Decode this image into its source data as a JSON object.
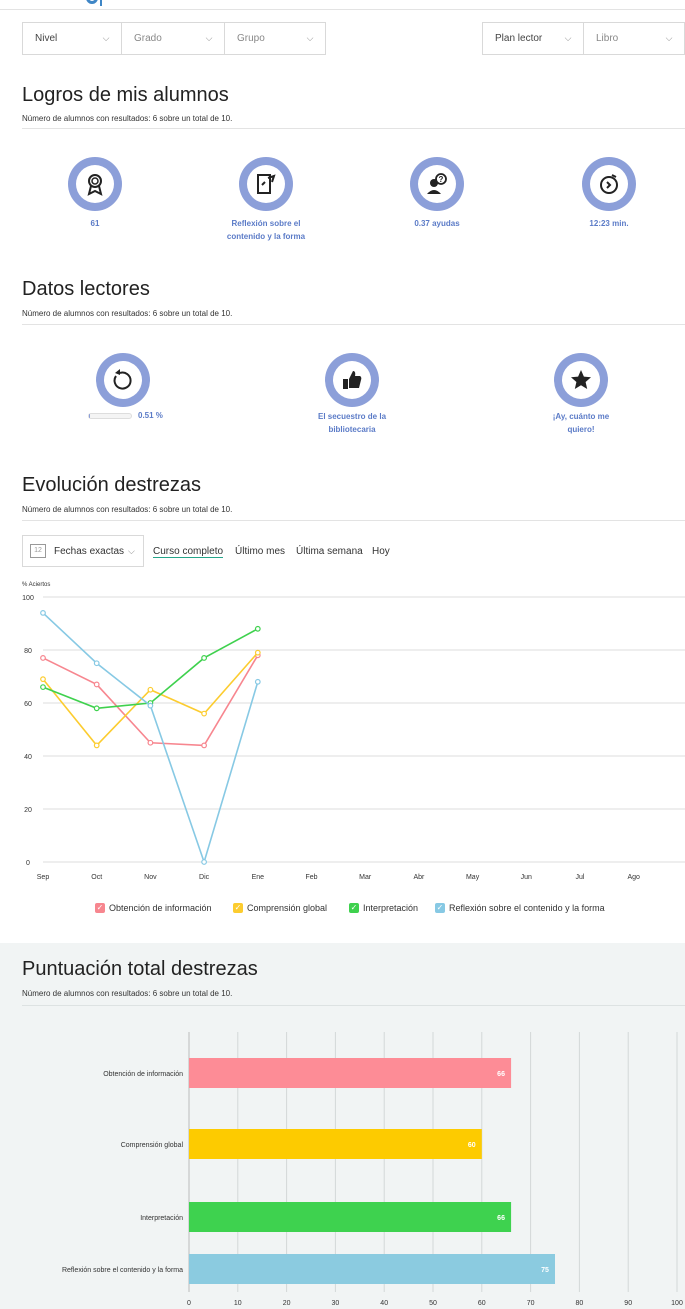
{
  "filters": {
    "nivel": "Nivel",
    "grado": "Grado",
    "grupo": "Grupo",
    "plan_lector": "Plan lector",
    "libro": "Libro"
  },
  "logros": {
    "title": "Logros de mis alumnos",
    "subtitle": "Número de alumnos con resultados: 6 sobre un total de 10.",
    "stats": [
      {
        "icon": "award-icon",
        "line1": "61",
        "line2": ""
      },
      {
        "icon": "document-edit-icon",
        "line1": "Reflexión sobre el",
        "line2": "contenido y la forma"
      },
      {
        "icon": "help-user-icon",
        "line1": "0.37 ayudas",
        "line2": ""
      },
      {
        "icon": "timer-icon",
        "line1": "12:23 min.",
        "line2": ""
      }
    ]
  },
  "datos": {
    "title": "Datos lectores",
    "subtitle": "Número de alumnos con resultados: 6 sobre un total de 10.",
    "progress_label": "0.51 %",
    "progress_value": 0.0051,
    "stats": [
      {
        "icon": "refresh-icon",
        "line1": "",
        "line2": ""
      },
      {
        "icon": "thumbs-up-icon",
        "line1": "El secuestro de la",
        "line2": "bibliotecaria"
      },
      {
        "icon": "star-icon",
        "line1": "¡Ay, cuánto me",
        "line2": "quiero!"
      }
    ]
  },
  "evolucion": {
    "title": "Evolución destrezas",
    "subtitle": "Número de alumnos con resultados: 6 sobre un total de 10.",
    "date_button": "Fechas exactas",
    "calendar_day": "12",
    "ranges": [
      "Curso completo",
      "Último mes",
      "Última semana",
      "Hoy"
    ],
    "active_range": "Curso completo"
  },
  "puntuacion": {
    "title": "Puntuación total destrezas",
    "subtitle": "Número de alumnos con resultados: 6 sobre un total de 10."
  },
  "colors": {
    "obtencion": "#f7868f",
    "comprension": "#fccc2f",
    "interpretacion": "#3fd14e",
    "reflexion": "#87c9e4",
    "accent": "#8c9fd9",
    "stat_text": "#5b7bc7"
  },
  "chart_data": [
    {
      "type": "line",
      "ylabel": "% Aciertos",
      "ylim": [
        0,
        100
      ],
      "yticks": [
        0,
        20,
        40,
        60,
        80,
        100
      ],
      "x": [
        "Sep",
        "Oct",
        "Nov",
        "Dic",
        "Ene",
        "Feb",
        "Mar",
        "Abr",
        "May",
        "Jun",
        "Jul",
        "Ago"
      ],
      "grid": true,
      "legend": "bottom",
      "series": [
        {
          "name": "Obtención de información",
          "color": "#f7868f",
          "values": [
            77,
            67,
            45,
            44,
            78
          ]
        },
        {
          "name": "Comprensión global",
          "color": "#fccc2f",
          "values": [
            69,
            44,
            65,
            56,
            79
          ]
        },
        {
          "name": "Interpretación",
          "color": "#3fd14e",
          "values": [
            66,
            58,
            60,
            77,
            88
          ]
        },
        {
          "name": "Reflexión sobre el contenido y la forma",
          "color": "#87c9e4",
          "values": [
            94,
            75,
            59,
            0,
            68
          ]
        }
      ]
    },
    {
      "type": "bar",
      "orientation": "horizontal",
      "xlim": [
        0,
        100
      ],
      "xticks": [
        0,
        10,
        20,
        30,
        40,
        50,
        60,
        70,
        80,
        90,
        100
      ],
      "grid": true,
      "categories": [
        "Obtención de información",
        "Comprensión global",
        "Interpretación",
        "Reflexión sobre el contenido y la forma"
      ],
      "values": [
        66,
        60,
        66,
        75
      ],
      "colors": [
        "#fd8c96",
        "#fdcb00",
        "#3ed24f",
        "#8bcbe0"
      ]
    }
  ]
}
